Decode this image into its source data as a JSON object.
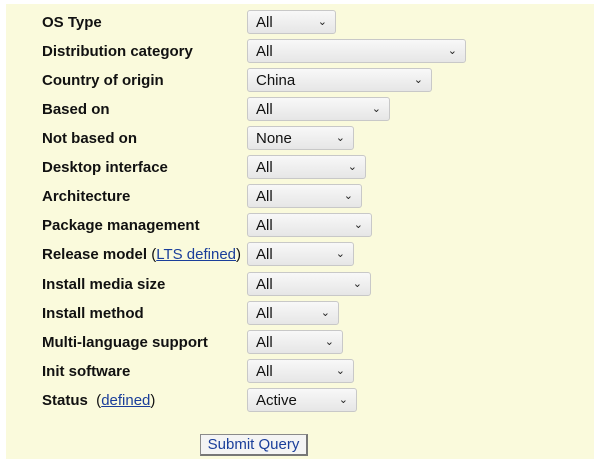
{
  "filters": [
    {
      "label": "OS Type",
      "value": "All"
    },
    {
      "label": "Distribution category",
      "value": "All"
    },
    {
      "label": "Country of origin",
      "value": "China"
    },
    {
      "label": "Based on",
      "value": "All"
    },
    {
      "label": "Not based on",
      "value": "None"
    },
    {
      "label": "Desktop interface",
      "value": "All"
    },
    {
      "label": "Architecture",
      "value": "All"
    },
    {
      "label": "Package management",
      "value": "All"
    },
    {
      "label": "Release model",
      "link_open": " (",
      "link": "LTS defined",
      "link_close": ")",
      "value": "All"
    },
    {
      "label": "Install media size",
      "value": "All"
    },
    {
      "label": "Install method",
      "value": "All"
    },
    {
      "label": "Multi-language support",
      "value": "All"
    },
    {
      "label": "Init software",
      "value": "All"
    },
    {
      "label": "Status",
      "link_open": "  (",
      "link": "defined",
      "link_close": ")",
      "value": "Active"
    }
  ],
  "submit_label": "Submit Query",
  "chevron": "⌄"
}
